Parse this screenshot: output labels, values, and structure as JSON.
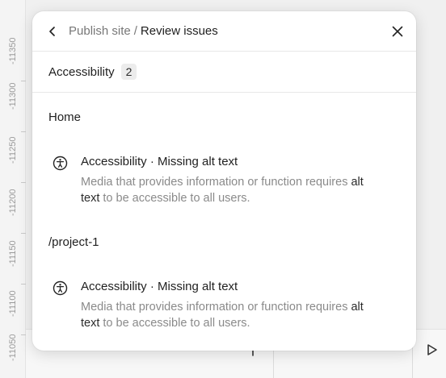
{
  "ruler": {
    "labels": [
      "-11350",
      "-11300",
      "-11250",
      "-11200",
      "-11150",
      "-11100",
      "-11050"
    ]
  },
  "panel": {
    "breadcrumb": {
      "parent": "Publish site",
      "separator": "/",
      "current": "Review issues"
    },
    "category": {
      "label": "Accessibility",
      "count": "2"
    },
    "pages": [
      {
        "heading": "Home",
        "issue": {
          "icon": "accessibility-icon",
          "title": "Accessibility · Missing alt text",
          "desc_pre": "Media that provides information or function requires ",
          "desc_emph": "alt text",
          "desc_post": " to be accessible to all users."
        }
      },
      {
        "heading": "/project-1",
        "issue": {
          "icon": "accessibility-icon",
          "title": "Accessibility · Missing alt text",
          "desc_pre": "Media that provides information or function requires ",
          "desc_emph": "alt text",
          "desc_post": " to be accessible to all users."
        }
      }
    ]
  },
  "toolbar": {
    "add_icon": "plus-icon",
    "preview_icon": "play-icon"
  }
}
